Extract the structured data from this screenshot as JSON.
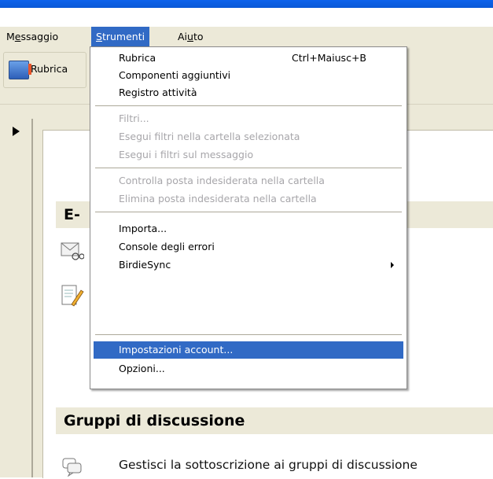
{
  "menubar": {
    "items": [
      {
        "label": "Messaggio"
      },
      {
        "label": "Strumenti"
      },
      {
        "label": "Aiuto"
      }
    ]
  },
  "toolbar": {
    "address_book_label": "Rubrica"
  },
  "content": {
    "email_header_partial": "E-",
    "newsgroups_header": "Gruppi di discussione",
    "newsgroups_subscribe": "Gestisci la sottoscrizione ai gruppi di discussione"
  },
  "dropdown": {
    "items": [
      {
        "label": "Rubrica",
        "shortcut": "Ctrl+Maiusc+B",
        "enabled": true
      },
      {
        "label": "Componenti aggiuntivi",
        "enabled": true
      },
      {
        "label": "Registro attività",
        "enabled": true
      },
      {
        "label": "Filtri...",
        "enabled": false
      },
      {
        "label": "Esegui filtri nella cartella selezionata",
        "enabled": false
      },
      {
        "label": "Esegui i filtri sul messaggio",
        "enabled": false
      },
      {
        "label": "Controlla posta indesiderata nella cartella",
        "enabled": false
      },
      {
        "label": "Elimina posta indesiderata nella cartella",
        "enabled": false
      },
      {
        "label": "Importa...",
        "enabled": true
      },
      {
        "label": "Console degli errori",
        "enabled": true
      },
      {
        "label": "BirdieSync",
        "enabled": true,
        "submenu": true
      },
      {
        "label": "Impostazioni account...",
        "enabled": true,
        "selected": true
      },
      {
        "label": "Opzioni...",
        "enabled": true
      }
    ]
  },
  "colors": {
    "selection": "#316ac5",
    "menu_bg": "#ece9d8",
    "disabled_text": "#a7a6aa"
  }
}
